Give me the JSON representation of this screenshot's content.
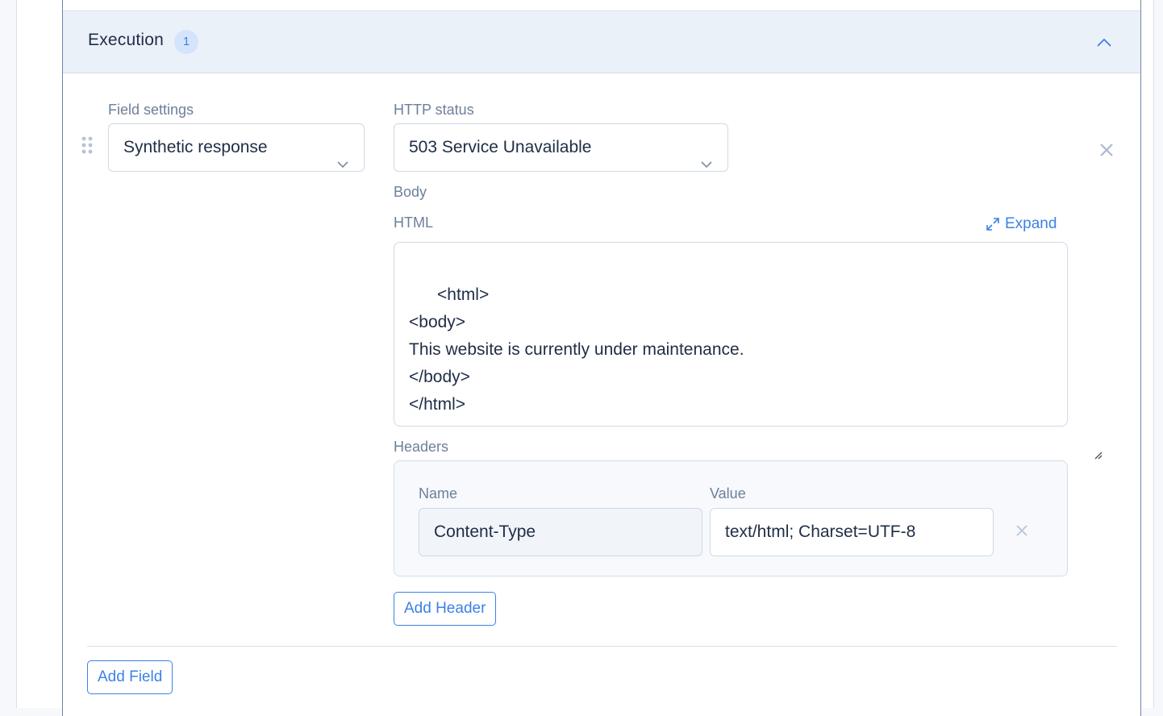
{
  "section": {
    "title": "Execution",
    "count": "1",
    "collapse_icon": "chevron-up-icon"
  },
  "field": {
    "settings_label": "Field settings",
    "settings_value": "Synthetic response",
    "http_status_label": "HTTP status",
    "http_status_value": "503 Service Unavailable",
    "body_label": "Body",
    "html_label": "HTML",
    "expand_label": "Expand",
    "html_body": "<html>\n<body>\nThis website is currently under maintenance.\n</body>\n</html>",
    "headers_label": "Headers",
    "headers": [
      {
        "name_label": "Name",
        "value_label": "Value",
        "name": "Content-Type",
        "value": "text/html; Charset=UTF-8"
      }
    ],
    "add_header_label": "Add Header"
  },
  "add_field_label": "Add Field",
  "colors": {
    "accent": "#3b82e6",
    "header_bg": "#ebf1f9",
    "label": "#6d7f9b",
    "text": "#1f2d45"
  }
}
